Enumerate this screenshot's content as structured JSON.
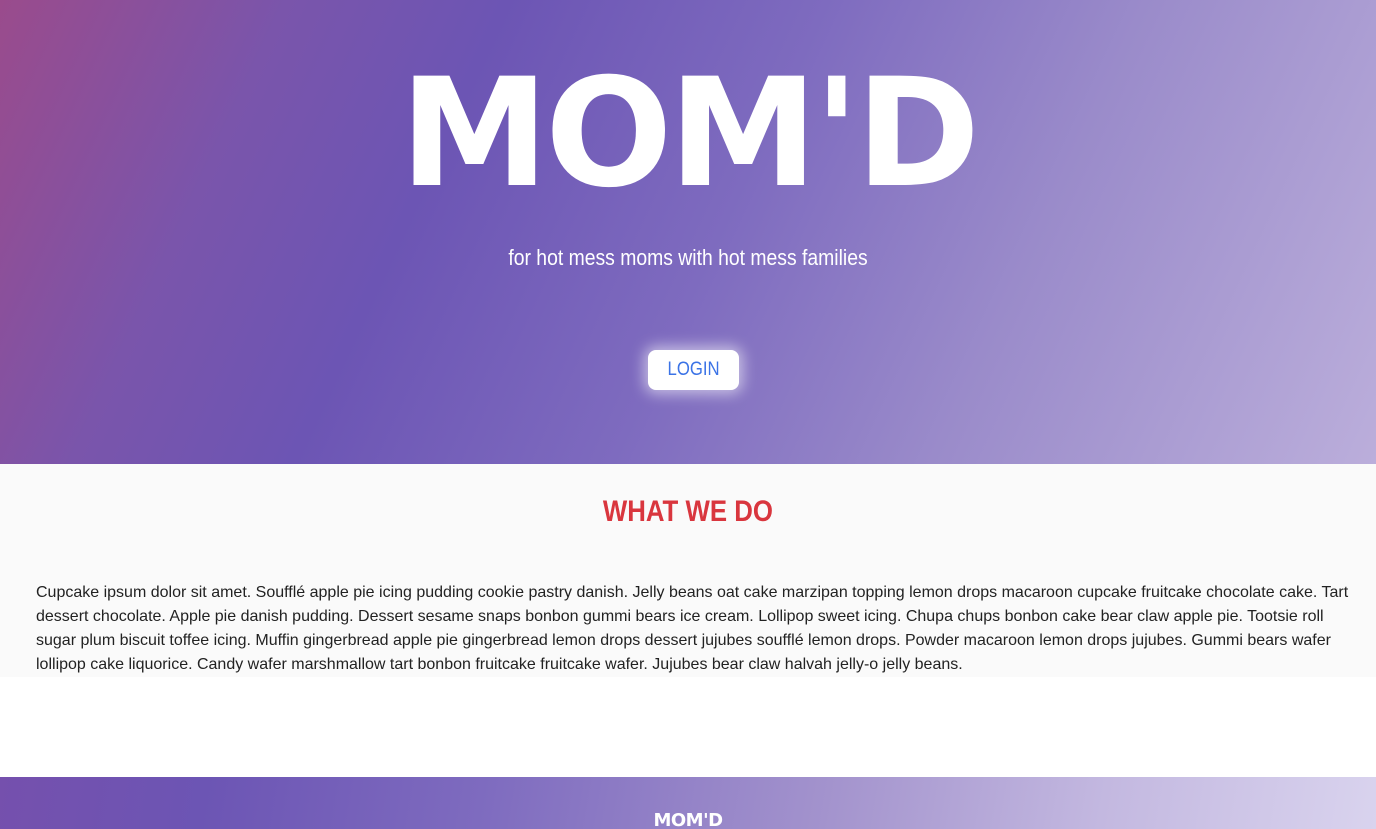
{
  "hero": {
    "logo": "MOM'D",
    "tagline": "for hot mess moms with hot mess families",
    "login_label": "LOGIN"
  },
  "about": {
    "title": "WHAT WE DO",
    "body": "Cupcake ipsum dolor sit amet. Soufflé apple pie icing pudding cookie pastry danish. Jelly beans oat cake marzipan topping lemon drops macaroon cupcake fruitcake chocolate cake. Tart dessert chocolate. Apple pie danish pudding. Dessert sesame snaps bonbon gummi bears ice cream. Lollipop sweet icing. Chupa chups bonbon cake bear claw apple pie. Tootsie roll sugar plum biscuit toffee icing. Muffin gingerbread apple pie gingerbread lemon drops dessert jujubes soufflé lemon drops. Powder macaroon lemon drops jujubes. Gummi bears wafer lollipop cake liquorice. Candy wafer marshmallow tart bonbon fruitcake fruitcake wafer. Jujubes bear claw halvah jelly-o jelly beans."
  },
  "footer": {
    "logo": "MOM'D"
  },
  "colors": {
    "accent_red": "#d9363e",
    "button_text_blue": "#3b73e6",
    "gradient_purple": "#6c55b4"
  }
}
